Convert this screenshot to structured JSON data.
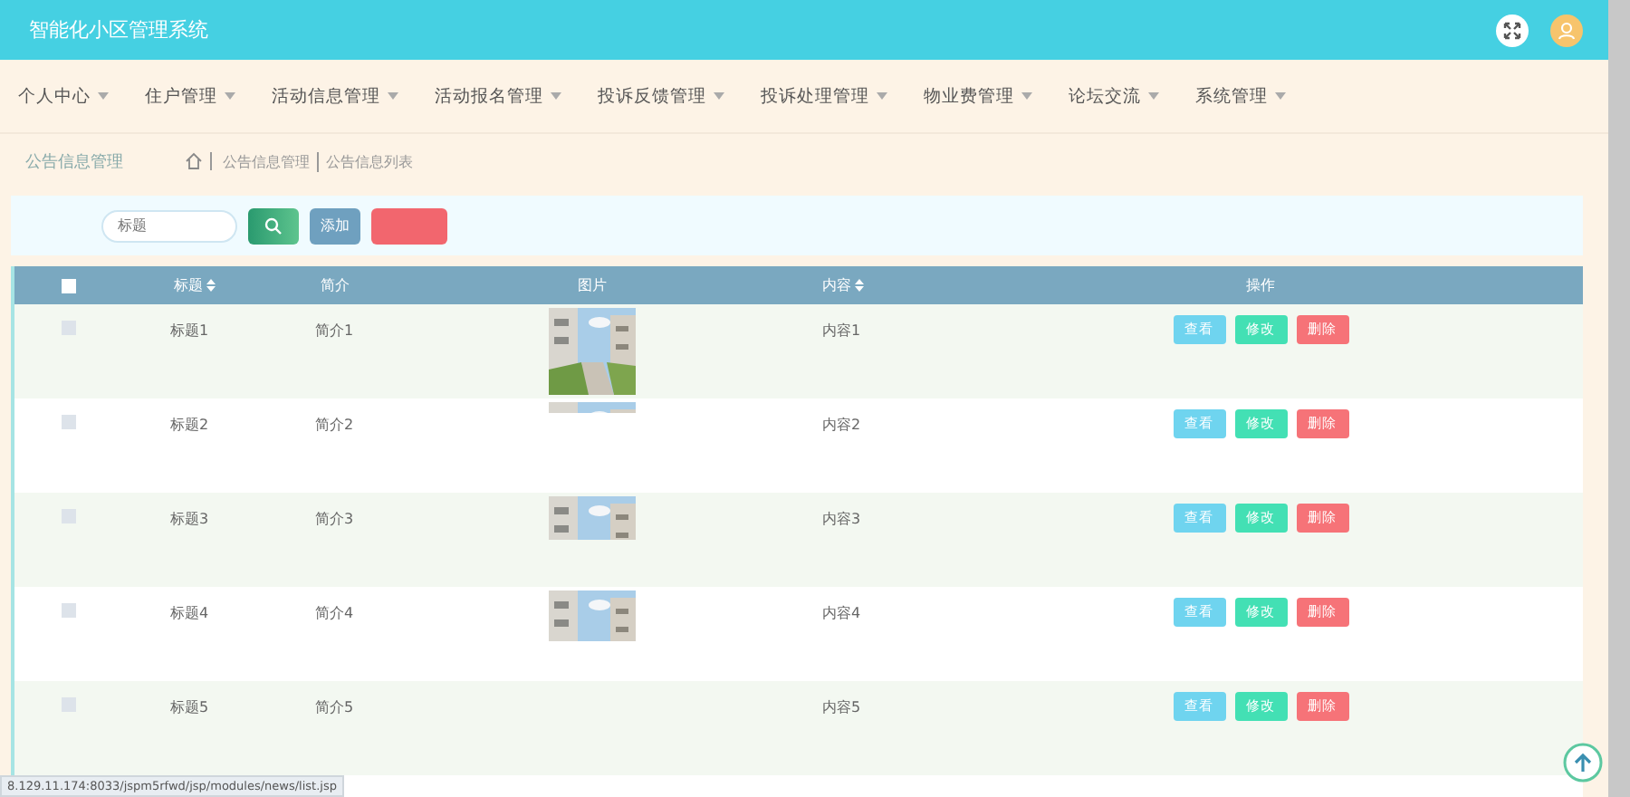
{
  "header": {
    "title": "智能化小区管理系统"
  },
  "nav": [
    {
      "label": "个人中心"
    },
    {
      "label": "住户管理"
    },
    {
      "label": "活动信息管理"
    },
    {
      "label": "活动报名管理"
    },
    {
      "label": "投诉反馈管理"
    },
    {
      "label": "投诉处理管理"
    },
    {
      "label": "物业费管理"
    },
    {
      "label": "论坛交流"
    },
    {
      "label": "系统管理"
    }
  ],
  "breadcrumb": {
    "page_title": "公告信息管理",
    "path": [
      "公告信息管理",
      "公告信息列表"
    ]
  },
  "toolbar": {
    "search": {
      "placeholder": "标题"
    },
    "add_button": "添加"
  },
  "table": {
    "header_checkbox": {
      "checked": false
    },
    "columns": [
      "标题",
      "简介",
      "图片",
      "内容",
      "操作"
    ],
    "rows": [
      {
        "checked": false,
        "title": "标题1",
        "brief": "简介1",
        "content": "内容1",
        "actions": [
          "查看",
          "修改",
          "删除"
        ]
      },
      {
        "checked": false,
        "title": "标题2",
        "brief": "简介2",
        "content": "内容2",
        "actions": [
          "查看",
          "修改",
          "删除"
        ]
      },
      {
        "checked": false,
        "title": "标题3",
        "brief": "简介3",
        "content": "内容3",
        "actions": [
          "查看",
          "修改",
          "删除"
        ]
      },
      {
        "checked": false,
        "title": "标题4",
        "brief": "简介4",
        "content": "内容4",
        "actions": [
          "查看",
          "修改",
          "删除"
        ]
      },
      {
        "checked": false,
        "title": "标题5",
        "brief": "简介5",
        "content": "内容5",
        "actions": [
          "查看",
          "修改",
          "删除"
        ]
      }
    ]
  },
  "status_url": "8.129.11.174:8033/jspm5rfwd/jsp/modules/news/list.jsp"
}
